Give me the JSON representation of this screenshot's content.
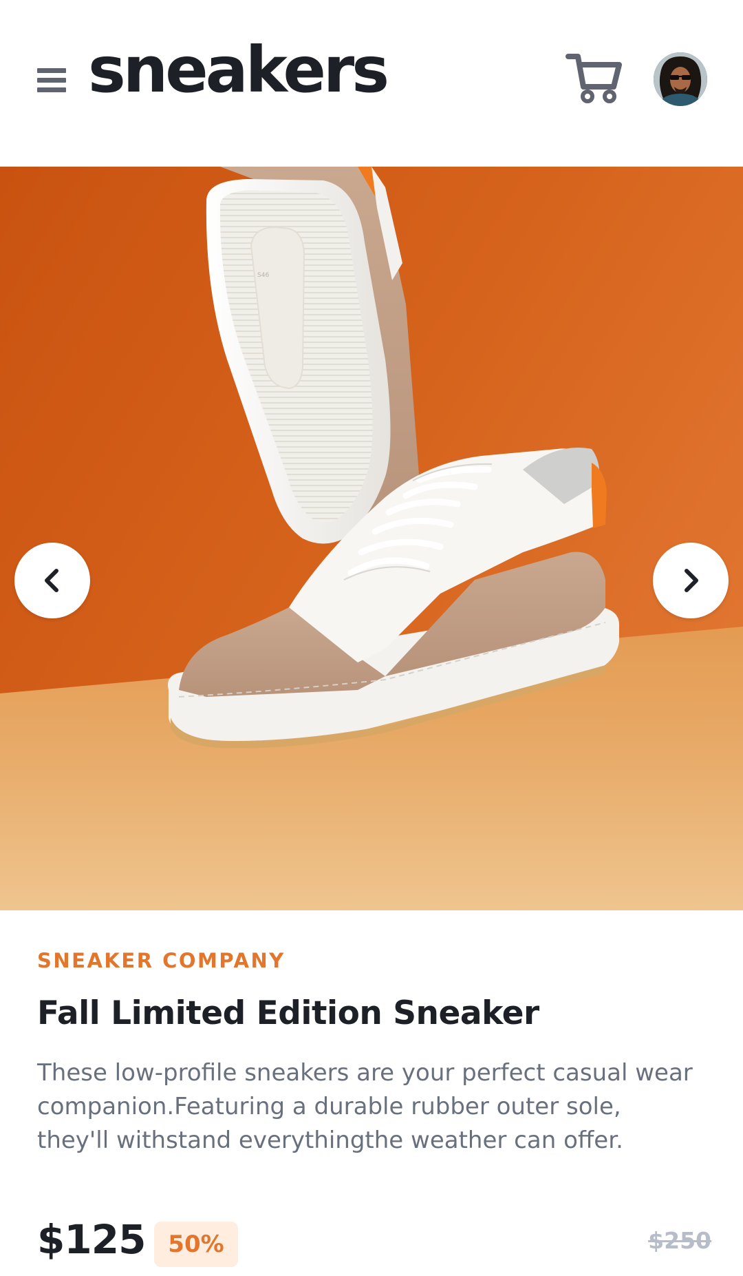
{
  "header": {
    "logo_text": "sneakers",
    "menu_icon": "hamburger-menu-icon",
    "cart_icon": "cart-icon"
  },
  "hero": {
    "image_subject": "sneaker-photo",
    "prev_icon": "chevron-left-icon",
    "next_icon": "chevron-right-icon"
  },
  "product": {
    "company": "SNEAKER COMPANY",
    "title": "Fall Limited Edition Sneaker",
    "description": "These low-profile sneakers are your perfect casual wear companion.Featuring a durable rubber outer sole, they'll withstand everythingthe weather can offer.",
    "price": "$125",
    "discount": "50%",
    "original_price": "$250"
  },
  "colors": {
    "accent": "#e2762c",
    "accent_pale": "#ffede0",
    "dark": "#1d2026",
    "grey_text": "#69707d",
    "muted": "#b6bcc8"
  }
}
